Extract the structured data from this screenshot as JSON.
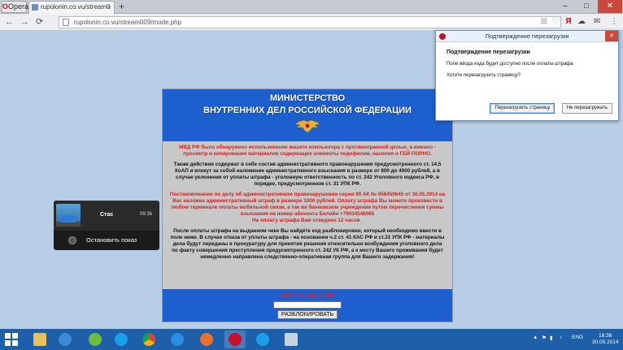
{
  "browser": {
    "menu_label": "Opera",
    "tab_title": "rupolonin.co.vu/stream0",
    "new_tab": "+",
    "url": "rupolonin.co.vu/stream009/mode.php"
  },
  "ransom": {
    "title_line1": "МИНИСТЕРСТВО",
    "title_line2": "ВНУТРЕННИХ ДЕЛ РОССИЙСКОЙ ФЕДЕРАЦИИ",
    "para1": "МВД РФ было обнаружено использование вашего компьютера с противоправной целью, а именно - просмотр и копирование материалов содержащих элементы педофилии, насилия и ГЕЙ-ПОРНО.",
    "para2": "Также действия содержат в себе состав административного правонарушения предусмотренного ст. 14.5 КоАП и влекут за собой наложение административного взыскания в размере от 800 до 4000 рублей, а в случае уклонения от уплаты штрафа - уголовную ответственность по ст. 242 Уголовного кодекса РФ, в порядке, предусмотренном ст. 31 УПК РФ.",
    "para3": "Постановлением по делу об административном правонарушении серия 99 АК № 658459645 от 30.05.2014 на Вас наложен административный штраф в размере 1000 рублей. Оплату штрафа Вы можете произвести в любом терминале оплаты мобильной связи, а так же банковском учреждении путем перечисления суммы взыскания на номер абонента Билайн +79034548085",
    "para3_tail": "На оплату штрафа Вам отведено 12 часов .",
    "para4": "После оплаты штрафа на выданном чеке Вы найдёте код разблокировки, который необходимо ввести в поле ниже. В случае отказа от уплаты штрафа - на основании ч.2 ст. 41 КАС РФ и ст.31 УПК РФ - материалы дела будут переданы в прокуратуру для принятия решения относительно возбуждения уголовного дела по факту совершения преступления предусмотренного ст. 242 УК РФ, а к месту Вашего проживания будет немедленно направлена следственно-оперативная группа для Вашего задержания!",
    "code_label": "0091 5 А 1441 1-099",
    "unlock_button": "РАЗБЛОКИРОВАТЬ"
  },
  "media": {
    "title": "Стас",
    "time": "09:36",
    "stop_label": "Остановить показ"
  },
  "dialog": {
    "title": "Подтверждение перезагрузки",
    "heading": "Подтверждение перезагрузки",
    "text1": "Поле ввода кода будет доступно после оплаты штрафа",
    "text2": "Хотите перезагрузить страницу?",
    "reload_button": "Перезагрузить страницу",
    "cancel_button": "Не перезагружать"
  },
  "taskbar": {
    "language": "ENG",
    "time": "18:36",
    "date": "30.05.2014"
  },
  "colors": {
    "accent_blue": "#1d5fcf",
    "alert_red": "#d42020",
    "taskbar": "#1d5fa8"
  }
}
